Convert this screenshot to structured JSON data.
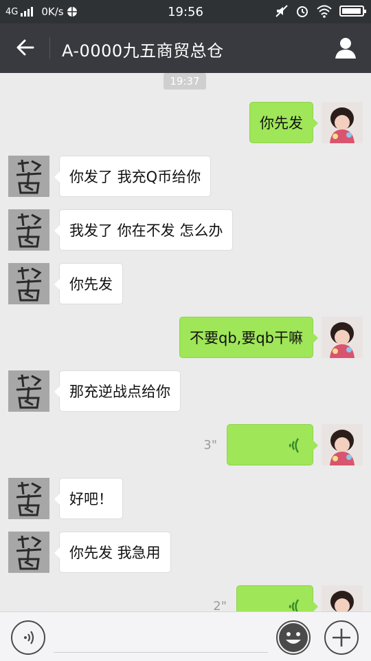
{
  "status_bar": {
    "network": "4G",
    "speed": "0K/s",
    "time": "19:56",
    "battery_level": 0.95
  },
  "header": {
    "title": "A-0000九五商贸总仓"
  },
  "chat": {
    "timestamp": "19:37",
    "messages": [
      {
        "side": "out",
        "type": "text",
        "text": "你先发"
      },
      {
        "side": "in",
        "type": "text",
        "text": "你发了 我充Q币给你"
      },
      {
        "side": "in",
        "type": "text",
        "text": "我发了 你在不发  怎么办"
      },
      {
        "side": "in",
        "type": "text",
        "text": "你先发"
      },
      {
        "side": "out",
        "type": "text",
        "text": "不要qb,要qb干嘛"
      },
      {
        "side": "in",
        "type": "text",
        "text": "那充逆战点给你"
      },
      {
        "side": "out",
        "type": "voice",
        "duration": "3\""
      },
      {
        "side": "in",
        "type": "text",
        "text": "好吧！"
      },
      {
        "side": "in",
        "type": "text",
        "text": "你先发  我急用"
      },
      {
        "side": "out",
        "type": "voice",
        "duration": "2\""
      }
    ]
  },
  "icons": {
    "back": "arrow-left-icon",
    "contact": "person-icon",
    "voice_input": "voice-input-icon",
    "emoji": "emoji-icon",
    "more": "plus-icon"
  },
  "colors": {
    "outgoing_bubble": "#9fe658",
    "incoming_bubble": "#ffffff",
    "header": "#393a3f"
  }
}
